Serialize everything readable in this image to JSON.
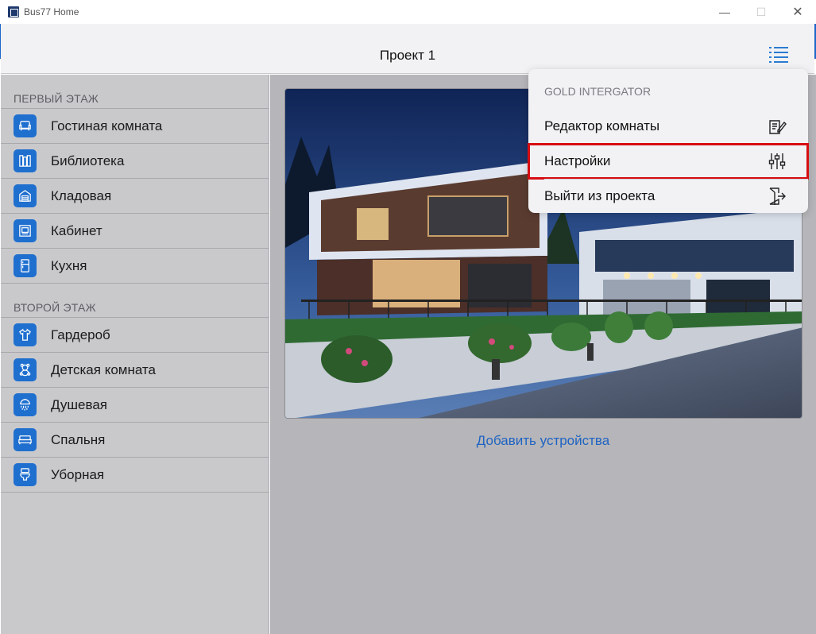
{
  "window": {
    "title": "Bus77 Home",
    "minimize": "—",
    "maximize": "☐",
    "close": "✕"
  },
  "header": {
    "project_title": "Проект 1",
    "menu_icon": "list-menu-icon"
  },
  "sidebar": {
    "sections": [
      {
        "title": "ПЕРВЫЙ ЭТАЖ",
        "rooms": [
          {
            "label": "Гостиная комната",
            "icon": "sofa-icon"
          },
          {
            "label": "Библиотека",
            "icon": "books-icon"
          },
          {
            "label": "Кладовая",
            "icon": "storage-icon"
          },
          {
            "label": "Кабинет",
            "icon": "office-icon"
          },
          {
            "label": "Кухня",
            "icon": "fridge-icon"
          }
        ]
      },
      {
        "title": "ВТОРОЙ ЭТАЖ",
        "rooms": [
          {
            "label": "Гардероб",
            "icon": "shirt-icon"
          },
          {
            "label": "Детская комната",
            "icon": "teddy-bear-icon"
          },
          {
            "label": "Душевая",
            "icon": "shower-icon"
          },
          {
            "label": "Спальня",
            "icon": "bed-icon"
          },
          {
            "label": "Уборная",
            "icon": "toilet-icon"
          }
        ]
      }
    ]
  },
  "main": {
    "add_devices": "Добавить устройства"
  },
  "dropdown": {
    "header": "GOLD INTERGATOR",
    "items": [
      {
        "label": "Редактор комнаты",
        "icon": "edit-icon"
      },
      {
        "label": "Настройки",
        "icon": "sliders-icon",
        "highlighted": true
      },
      {
        "label": "Выйти из проекта",
        "icon": "exit-icon"
      }
    ]
  },
  "colors": {
    "accent": "#1f6fcf",
    "link": "#1f63c2",
    "highlight": "#d60d12",
    "sidebar_bg": "#c9c9cc",
    "main_bg": "#b6b6ba"
  }
}
